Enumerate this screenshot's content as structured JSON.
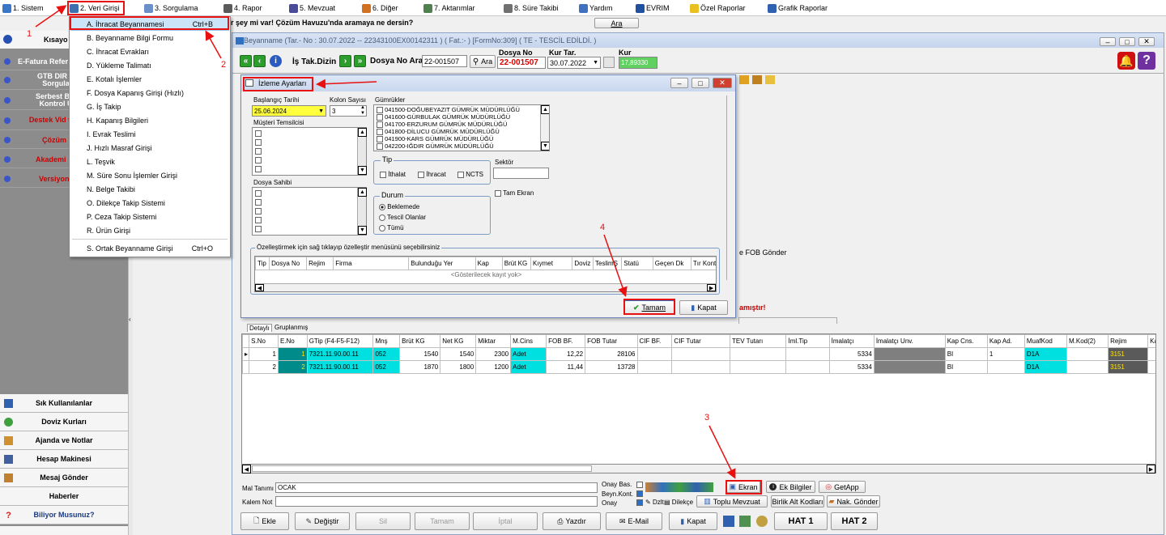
{
  "menu": [
    "1. Sistem",
    "2. Veri Girişi",
    "3. Sorgulama",
    "4. Rapor",
    "5. Mevzuat",
    "6. Diğer",
    "7. Aktarımlar",
    "8. Süre Takibi",
    "Yardım",
    "EVRIM",
    "Özel Raporlar",
    "Grafik Raporlar"
  ],
  "search_prompt": "r şey mi var! Çözüm Havuzu'nda aramaya ne dersin?",
  "search_button": "Ara",
  "left": {
    "title": "Kısayo",
    "items": [
      "E-Fatura Refer",
      "GTB DIR B Sorgula",
      "Serbest Böl Kontrol U",
      "Destek Vid tıkla",
      "Çözüm",
      "Akademi",
      "Versiyon"
    ],
    "buttons": [
      "Sık Kullanılanlar",
      "Doviz Kurları",
      "Ajanda ve Notlar",
      "Hesap Makinesi",
      "Mesaj Gönder",
      "Haberler",
      "Biliyor Musunuz?"
    ]
  },
  "dropdown": {
    "items": [
      {
        "label": "A.  İhracat Beyannamesi",
        "shortcut": "Ctrl+B"
      },
      {
        "label": "B.  Beyanname Bilgi Formu",
        "shortcut": ""
      },
      {
        "label": "C.  İhracat Evrakları",
        "shortcut": ""
      },
      {
        "label": "D.  Yükleme Talimatı",
        "shortcut": ""
      },
      {
        "label": "E.  Kotalı İşlemler",
        "shortcut": ""
      },
      {
        "label": "F.  Dosya Kapanış Girişi (Hızlı)",
        "shortcut": ""
      },
      {
        "label": "G.  İş Takip",
        "shortcut": ""
      },
      {
        "label": "H.  Kapanış Bilgileri",
        "shortcut": ""
      },
      {
        "label": "I.  Evrak Teslimi",
        "shortcut": ""
      },
      {
        "label": "J.  Hızlı Masraf Girişi",
        "shortcut": ""
      },
      {
        "label": "L.  Teşvik",
        "shortcut": ""
      },
      {
        "label": "M.  Süre Sonu İşlemler Girişi",
        "shortcut": ""
      },
      {
        "label": "N.  Belge Takibi",
        "shortcut": ""
      },
      {
        "label": "O.  Dilekçe Takip Sistemi",
        "shortcut": ""
      },
      {
        "label": "P.  Ceza Takip Sistemi",
        "shortcut": ""
      },
      {
        "label": "R.  Ürün Girişi",
        "shortcut": ""
      },
      {
        "label": "S.  Ortak Beyanname Girişi",
        "shortcut": "Ctrl+O"
      }
    ]
  },
  "decl": {
    "title": "Beyanname (Tar.- No : 30.07.2022 -- 22343100EX00142311 ) ( Fat.:- )  [FormNo:309] ( TE - TESCİL EDİLDİ. )",
    "is_tak": "İş Tak.Dizin",
    "dosya_ara_label": "Dosya No Ara",
    "dosya_ara_value": "22-001507",
    "ara": "Ara",
    "dosya_no_label": "Dosya No",
    "dosya_no_value": "22-001507",
    "kur_tar_label": "Kur Tar.",
    "kur_tar_value": "30.07.2022",
    "kur_label": "Kur",
    "kur_value": "17,89330",
    "fob_gonder": "e FOB Gönder",
    "warning": "amıştır!",
    "tabs": [
      "Detaylı",
      "Gruplanmış"
    ]
  },
  "grid": {
    "headers": [
      "S.No",
      "E.No",
      "GTip (F4-F5-F12)",
      "Mnş",
      "Brüt KG",
      "Net KG",
      "Miktar",
      "M.Cins",
      "FOB BF.",
      "FOB Tutar",
      "CIF BF.",
      "CIF Tutar",
      "TEV Tutarı",
      "İml.Tip",
      "İmalatçı",
      "İmalatçı Unv.",
      "Kap Cns.",
      "Kap Ad.",
      "MuafKod",
      "M.Kod(2)",
      "Rejim",
      "Katego"
    ],
    "rows": [
      [
        "1",
        "1",
        "7321.11.90.00.11",
        "052",
        "1540",
        "1540",
        "2300",
        "Adet",
        "12,22",
        "28106",
        "",
        "",
        "",
        "",
        "5334",
        "",
        "BI",
        "1",
        "D1A",
        "",
        "3151",
        ""
      ],
      [
        "2",
        "2",
        "7321.11.90.00.11",
        "052",
        "1870",
        "1800",
        "1200",
        "Adet",
        "11,44",
        "13728",
        "",
        "",
        "",
        "",
        "5334",
        "",
        "BI",
        "",
        "D1A",
        "",
        "3151",
        ""
      ]
    ]
  },
  "bottom": {
    "mal_tanimi_label": "Mal Tanımı",
    "mal_tanimi_value": "OCAK",
    "kalem_not_label": "Kalem Not",
    "onay_bas": "Onay Bas.",
    "beyn_kont": "Beyn.Kont.",
    "onay": "Onay",
    "dzlt": "Dzlt",
    "dilekce": "Dilekçe",
    "ekran": "Ekran",
    "ek_bilgiler": "Ek Bilgiler",
    "getapp": "GetApp",
    "toplu_mevzuat": "Toplu Mevzuat",
    "birlik_alt": "Birlik Alt Kodları",
    "nak_gonder": "Nak. Gönder",
    "buttons": [
      "Ekle",
      "Değiştir",
      "Sil",
      "Tamam",
      "İptal",
      "Yazdır",
      "E-Mail",
      "Kapat"
    ],
    "hat1": "HAT 1",
    "hat2": "HAT 2"
  },
  "dialog": {
    "title": "İzleme Ayarları",
    "baslangic_label": "Başlangıç Tarihi",
    "baslangic_value": "25.06.2024",
    "kolon_label": "Kolon Sayısı",
    "kolon_value": "3",
    "musteri_label": "Müşteri Temsilcisi",
    "dosya_sahibi_label": "Dosya Sahibi",
    "gumrukler_label": "Gümrükler",
    "gumrukler": [
      "041500-DOĞUBEYAZIT GÜMRÜK MÜDÜRLÜĞÜ",
      "041600-GÜRBULAK GÜMRÜK MÜDÜRLÜĞÜ",
      "041700-ERZURUM GÜMRÜK MÜDÜRLÜĞÜ",
      "041800-DİLUCU GÜMRÜK MÜDÜRLÜĞÜ",
      "041900-KARS GÜMRÜK MÜDÜRLÜĞÜ",
      "042200-IĞDIR GÜMRÜK MÜDÜRLÜĞÜ"
    ],
    "tip_label": "Tip",
    "tip": [
      "İthalat",
      "İhracat",
      "NCTS"
    ],
    "sektor_label": "Sektör",
    "tam_ekran": "Tam Ekran",
    "durum_label": "Durum",
    "durum": [
      "Beklemede",
      "Tescil Olanlar",
      "Tümü"
    ],
    "ozel_label": "Özelleştirmek için sağ tıklayıp özelleştir menüsünü seçebilirsiniz",
    "cols": [
      "Tip",
      "Dosya No",
      "Rejim",
      "Firma",
      "Bulunduğu Yer",
      "Kap",
      "Brüt KG",
      "Kıymet",
      "Doviz",
      "TeslimŞ",
      "Statü",
      "Geçen Dk",
      "Tır Konte"
    ],
    "empty": "<Gösterilecek kayıt yok>",
    "tamam": "Tamam",
    "kapat": "Kapat"
  },
  "annotations": [
    "1",
    "2",
    "3",
    "4"
  ]
}
